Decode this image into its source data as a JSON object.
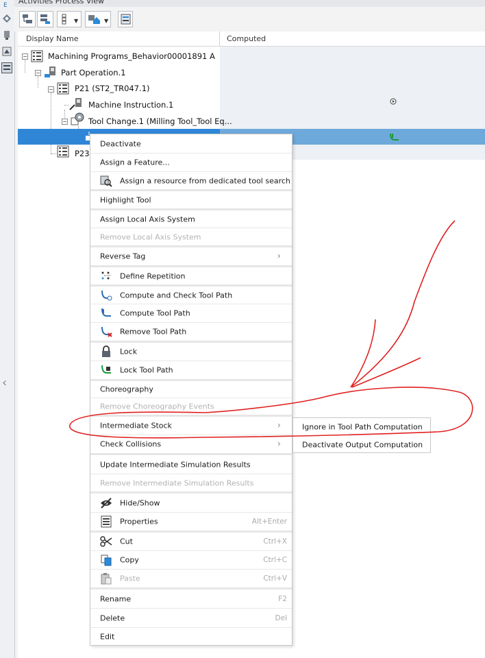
{
  "panel_title": "Activities Process View",
  "columns": [
    "Display Name",
    "Computed"
  ],
  "tree": [
    {
      "label": "Machining Programs_Behavior00001891 A"
    },
    {
      "label": "Part Operation.1"
    },
    {
      "label": "P21 (ST2_TR047.1)"
    },
    {
      "label": "Machine Instruction.1"
    },
    {
      "label": "Tool Change.1 (Milling Tool_Tool Eq..."
    },
    {
      "label": "P23"
    }
  ],
  "context_menu": [
    {
      "label": "Deactivate",
      "disabled": false
    },
    {
      "label": "Assign a Feature...",
      "disabled": false
    },
    {
      "label": "Assign a resource from dedicated tool search",
      "icon": "resource-search-icon"
    },
    {
      "label": "Highlight Tool"
    },
    {
      "label": "Assign Local Axis System"
    },
    {
      "label": "Remove Local Axis System",
      "disabled": true
    },
    {
      "label": "Reverse Tag",
      "submenu": true
    },
    {
      "label": "Define Repetition",
      "icon": "repetition-icon"
    },
    {
      "label": "Compute and Check Tool Path",
      "icon": "compute-check-toolpath-icon"
    },
    {
      "label": "Compute Tool Path",
      "icon": "compute-toolpath-icon"
    },
    {
      "label": "Remove Tool Path",
      "icon": "remove-toolpath-icon"
    },
    {
      "label": "Lock",
      "icon": "lock-icon"
    },
    {
      "label": "Lock Tool Path",
      "icon": "lock-toolpath-icon"
    },
    {
      "label": "Choreography"
    },
    {
      "label": "Remove Choreography Events",
      "disabled": true
    },
    {
      "label": "Intermediate Stock",
      "submenu": true
    },
    {
      "label": "Check Collisions",
      "submenu": true
    },
    {
      "label": "Update Intermediate Simulation Results"
    },
    {
      "label": "Remove Intermediate Simulation Results",
      "disabled": true
    },
    {
      "label": "Hide/Show",
      "icon": "hide-show-icon"
    },
    {
      "label": "Properties",
      "icon": "properties-icon",
      "shortcut": "Alt+Enter"
    },
    {
      "label": "Cut",
      "icon": "scissors-icon",
      "shortcut": "Ctrl+X"
    },
    {
      "label": "Copy",
      "icon": "copy-icon",
      "shortcut": "Ctrl+C"
    },
    {
      "label": "Paste",
      "icon": "paste-icon",
      "shortcut": "Ctrl+V",
      "disabled": true
    },
    {
      "label": "Rename",
      "shortcut": "F2"
    },
    {
      "label": "Delete",
      "shortcut": "Del"
    },
    {
      "label": "Edit"
    }
  ],
  "submenu": [
    {
      "label": "Ignore in Tool Path Computation"
    },
    {
      "label": "Deactivate Output Computation"
    }
  ],
  "annotation_color": "#e02020",
  "selection_color": "#2f86d6"
}
